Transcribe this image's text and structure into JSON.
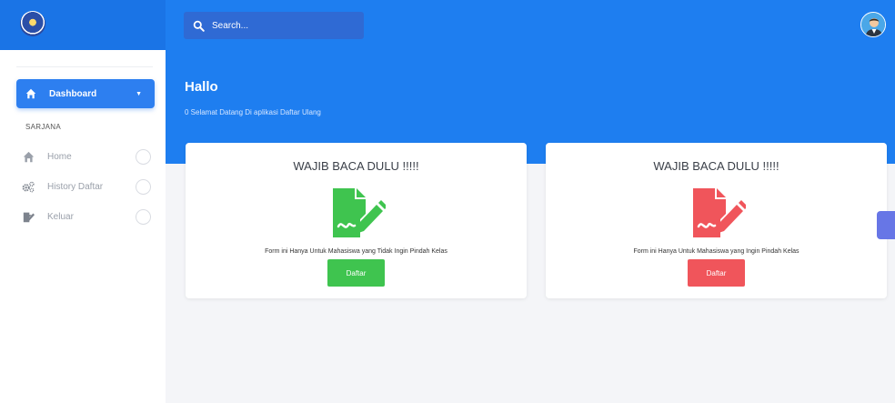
{
  "header": {
    "search_placeholder": "Search...",
    "colors": {
      "topbar": "#1e7ef0",
      "search_bg": "#2f6ad4"
    },
    "icons": {
      "logo": "university-logo",
      "search": "search-icon",
      "avatar": "user-avatar"
    }
  },
  "sidebar": {
    "active_item": {
      "label": "Dashboard",
      "icon": "home-icon",
      "caret": "▼"
    },
    "section_label": "SARJANA",
    "items": [
      {
        "label": "Home",
        "icon": "home-icon"
      },
      {
        "label": "History Daftar",
        "icon": "gears-icon"
      },
      {
        "label": "Keluar",
        "icon": "edit-icon"
      }
    ]
  },
  "banner": {
    "title": "Hallo",
    "subtitle": "0 Selamat Datang Di aplikasi Daftar Ulang"
  },
  "cards": [
    {
      "title": "WAJIB BACA DULU !!!!!",
      "description": "Form ini Hanya Untuk Mahasiswa yang Tidak Ingin Pindah Kelas",
      "button_label": "Daftar",
      "color": "#3fc44f"
    },
    {
      "title": "WAJIB BACA DULU !!!!!",
      "description": "Form ini Hanya Untuk Mahasiswa yang Ingin Pindah Kelas",
      "button_label": "Daftar",
      "color": "#f0555b"
    }
  ]
}
